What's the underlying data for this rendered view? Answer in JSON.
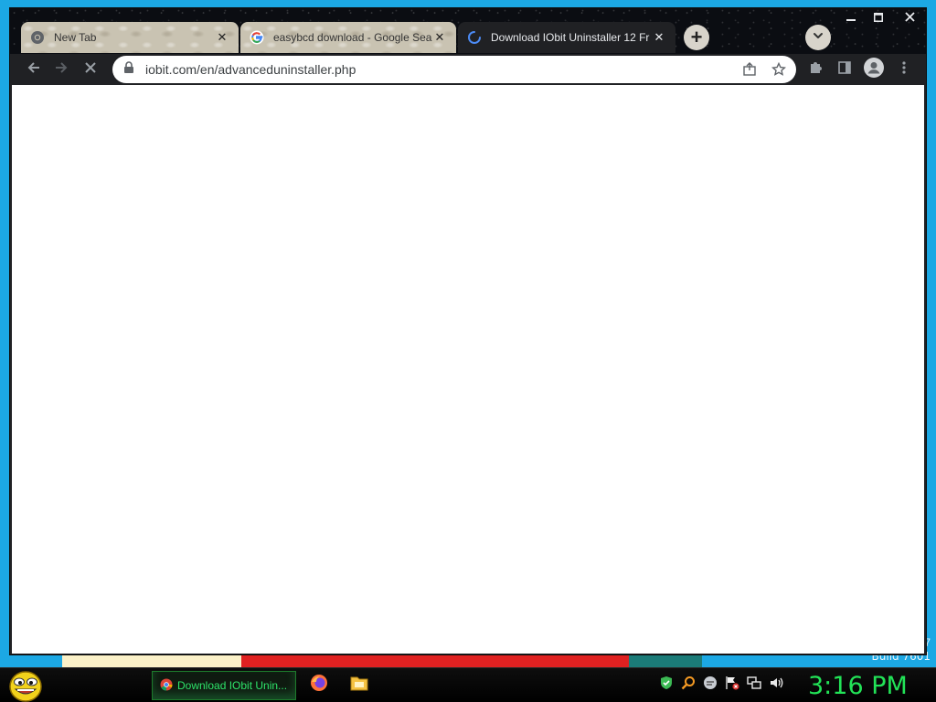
{
  "desktop": {
    "build_number": "7",
    "build_text": "Build 7601"
  },
  "browser": {
    "tabs": [
      {
        "label": "New Tab",
        "active": false,
        "icon": "chrome-icon"
      },
      {
        "label": "easybcd download - Google Sea",
        "active": false,
        "icon": "google-icon"
      },
      {
        "label": "Download IObit Uninstaller 12 Fr",
        "active": true,
        "icon": "loading-spinner-icon"
      }
    ],
    "new_tab_symbol": "+",
    "address_bar": {
      "url": "iobit.com/en/advanceduninstaller.php"
    },
    "window_controls": {
      "minimize": "–",
      "maximize": "▢",
      "close": "✕"
    }
  },
  "taskbar": {
    "active_task": "Download IObit Unin...",
    "clock": "3:16 PM",
    "accent_color": "#22e357"
  }
}
